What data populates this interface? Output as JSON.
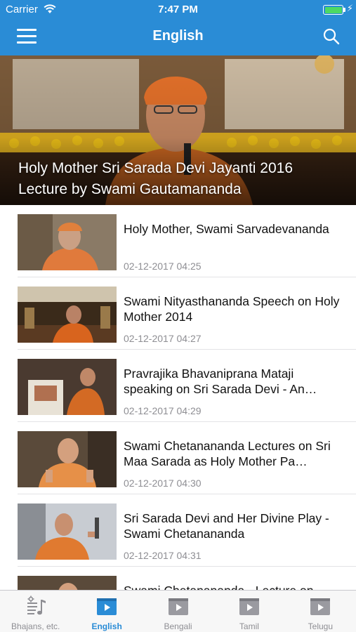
{
  "status_bar": {
    "carrier": "Carrier",
    "time": "7:47 PM"
  },
  "nav": {
    "title": "English"
  },
  "hero": {
    "title": "Holy Mother Sri Sarada Devi Jayanti 2016 Lecture by Swami Gautamananda"
  },
  "videos": [
    {
      "title": "Holy Mother, Swami Sarvadevananda",
      "date": "02-12-2017 04:25"
    },
    {
      "title": "Swami Nityasthananda Speech on Holy Mother 2014",
      "date": "02-12-2017 04:27"
    },
    {
      "title": "Pravrajika Bhavaniprana Mataji speaking on Sri Sarada Devi - An…",
      "date": "02-12-2017 04:29"
    },
    {
      "title": "Swami Chetanananda Lectures on Sri Maa Sarada as Holy Mother Pa…",
      "date": "02-12-2017 04:30"
    },
    {
      "title": "Sri Sarada Devi and Her Divine Play - Swami Chetanananda",
      "date": "02-12-2017 04:31"
    },
    {
      "title": "Swami Chetanananda - Lecture on",
      "date": ""
    }
  ],
  "tabs": [
    {
      "label": "Bhajans, etc.",
      "icon": "music-notes-icon",
      "active": false
    },
    {
      "label": "English",
      "icon": "video-icon",
      "active": true
    },
    {
      "label": "Bengali",
      "icon": "video-icon",
      "active": false
    },
    {
      "label": "Tamil",
      "icon": "video-icon",
      "active": false
    },
    {
      "label": "Telugu",
      "icon": "video-icon",
      "active": false
    }
  ],
  "colors": {
    "brand": "#2a8cd6",
    "active_tab": "#2a8cd6",
    "inactive_tab": "#8e8e93",
    "battery": "#4cd964"
  }
}
